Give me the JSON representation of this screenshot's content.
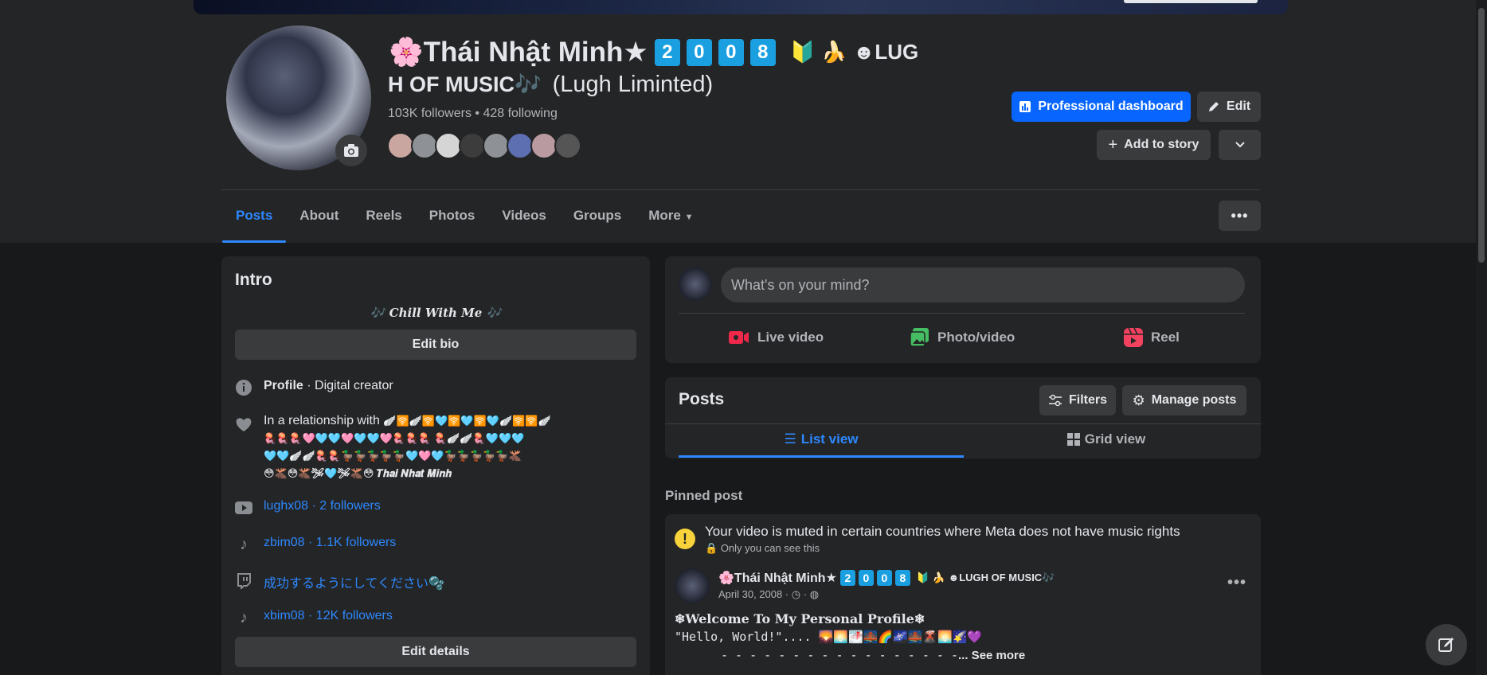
{
  "profile": {
    "name_prefix": "🌸Thái Nhật Minh★",
    "name_digits": [
      "2",
      "0",
      "0",
      "8"
    ],
    "name_suffix": "🔰 🍌 ☻LUG",
    "name_line2": "H OF MUSIC🎶",
    "name_line2_light": "(Lugh Liminted)",
    "stats": "103K followers • 428 following"
  },
  "actions": {
    "professional_dashboard": "Professional dashboard",
    "edit": "Edit",
    "add_to_story": "Add to story"
  },
  "tabs": [
    "Posts",
    "About",
    "Reels",
    "Photos",
    "Videos",
    "Groups",
    "More"
  ],
  "intro": {
    "title": "Intro",
    "bio": "🎶 Chill With Me 🎶",
    "edit_bio": "Edit bio",
    "profile_label": "Profile",
    "profile_type": " · Digital creator",
    "relationship_prefix": "In a relationship with ",
    "relationship_line1": "🪽🛜🪽🛜🩵🛜🩵🛜🩵🪽🛜🛜🪽",
    "relationship_line2": "🪼🪼🪼🩷🩵🩵🩷🩵🩵🩷🪼🪼🪼 🪼🪽🪽🪼🩵🩵🩵",
    "relationship_line3": "🩵🩵🪽🪽🪼🪼🦆🦆🦆🦆🦆🩵🩷🩵🦆🦆🦆🦆🦆🫎",
    "relationship_line4": "😳🫎😳🫎🛩🩵🛩🫎😳 𝑻𝒉𝒂𝒊 𝑵𝒉𝒂𝒕 𝑴𝒊𝒏𝒉",
    "youtube": "lughx08 · 2 followers",
    "tiktok1": "zbim08 · 1.1K followers",
    "twitch": "成功するようにしてください🫧",
    "tiktok2": "xbim08 · 12K followers",
    "edit_details": "Edit details"
  },
  "composer": {
    "placeholder": "What's on your mind?",
    "live": "Live video",
    "photo": "Photo/video",
    "reel": "Reel"
  },
  "posts_panel": {
    "title": "Posts",
    "filters": "Filters",
    "manage": "Manage posts",
    "list_view": "List view",
    "grid_view": "Grid view"
  },
  "pinned": {
    "label": "Pinned post",
    "warning": "Your video is muted in certain countries where Meta does not have music rights",
    "warning_sub": "Only you can see this",
    "author_prefix": "🌸Thái Nhật Minh★",
    "author_digits": [
      "2",
      "0",
      "0",
      "8"
    ],
    "author_suffix": "🔰 🍌 ☻LUGH OF MUSIC🎶",
    "date": "April 30, 2008 · ",
    "body1": "❄Welcome To My Personal Profile❄",
    "body2": "\"Hello, World!\".... 🌄🌅🌁🌉🌈🌌🌉🌋🌅🌠💜",
    "body3_dashes": "- - - - - - - - - - - - - - - - -",
    "see_more": "... See more"
  },
  "colors": {
    "accent": "#2d88ff",
    "primary_button": "#0866ff",
    "background": "#18191a",
    "surface": "#242526"
  }
}
